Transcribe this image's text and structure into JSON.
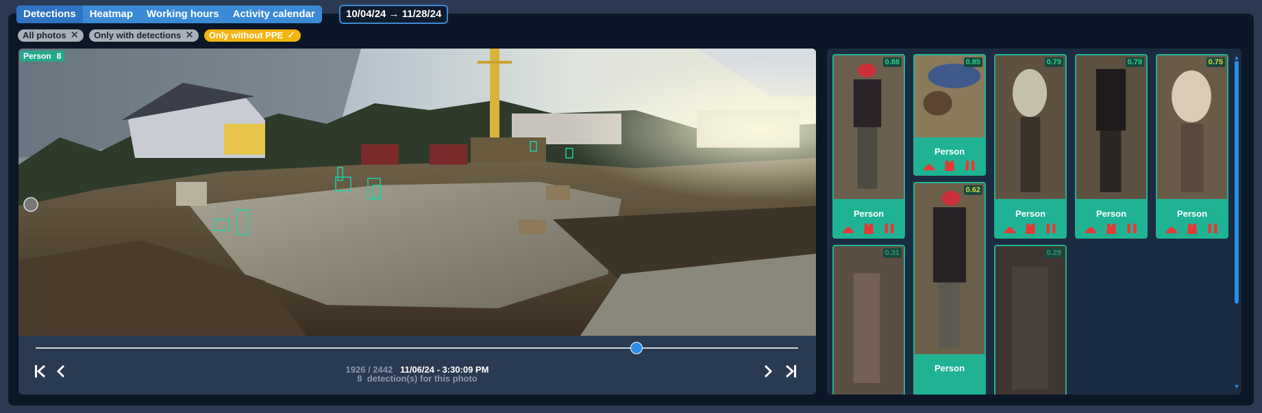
{
  "tabs": [
    {
      "label": "Detections",
      "active": true
    },
    {
      "label": "Heatmap",
      "active": false
    },
    {
      "label": "Working hours",
      "active": false
    },
    {
      "label": "Activity calendar",
      "active": false
    }
  ],
  "date_range": "10/04/24 → 11/28/24",
  "filters": [
    {
      "label": "All photos",
      "state": "off"
    },
    {
      "label": "Only with detections",
      "state": "off"
    },
    {
      "label": "Only without PPE",
      "state": "on"
    }
  ],
  "photo": {
    "badge_label": "Person",
    "badge_count": "8"
  },
  "player": {
    "position": "1926 / 2442",
    "timestamp": "11/06/24 - 3:30:09 PM",
    "detections_count": "8",
    "detections_text": "detection(s) for this photo",
    "progress": 0.788
  },
  "detections": [
    {
      "confidence": "0.88",
      "label": "Person"
    },
    {
      "confidence": "0.85",
      "label": "Person"
    },
    {
      "confidence": "0.79",
      "label": "Person"
    },
    {
      "confidence": "0.79",
      "label": "Person"
    },
    {
      "confidence": "0.75",
      "label": "Person"
    },
    {
      "confidence": "0.62",
      "label": "Person"
    },
    {
      "confidence": "0.31",
      "label": ""
    },
    {
      "confidence": "0.29",
      "label": ""
    }
  ],
  "colors": {
    "accent": "#3a8ad6",
    "detection": "#1fb394",
    "filter_on": "#f3b411",
    "ppe_missing": "#e53935"
  }
}
